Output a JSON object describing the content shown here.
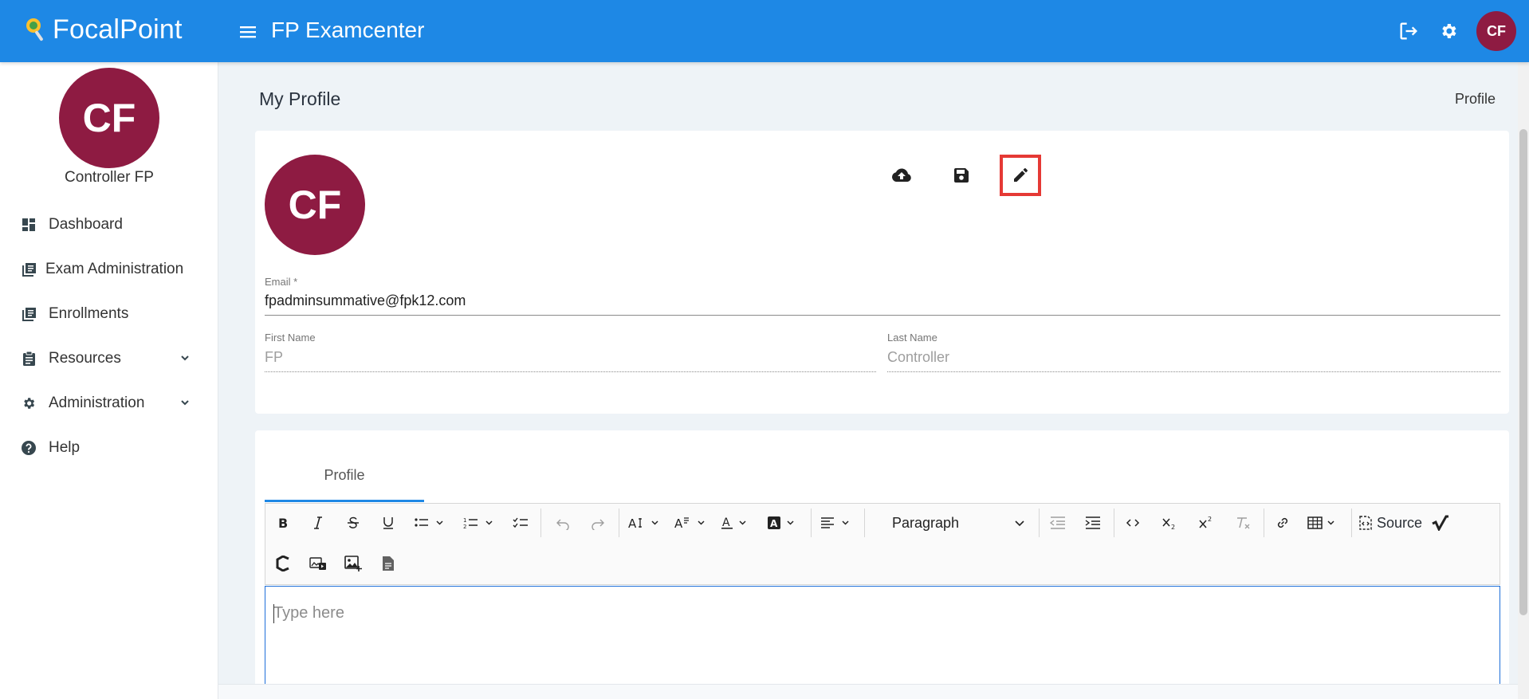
{
  "topbar": {
    "brand": "FocalPoint",
    "app_title": "FP Examcenter",
    "avatar_initials": "CF",
    "color": "#1e88e5"
  },
  "icons": {
    "menu": "menu-icon",
    "logout": "logout-icon",
    "settings": "gear-icon",
    "upload": "cloud-upload-icon",
    "save": "floppy-disk-icon",
    "edit": "pencil-icon"
  },
  "sidebar": {
    "avatar_initials": "CF",
    "username": "Controller FP",
    "items": [
      {
        "label": "Dashboard",
        "icon": "dashboard-icon"
      },
      {
        "label": "Exam Administration",
        "icon": "book-icon"
      },
      {
        "label": "Enrollments",
        "icon": "book-icon"
      },
      {
        "label": "Resources",
        "icon": "clipboard-icon",
        "expandable": true
      },
      {
        "label": "Administration",
        "icon": "gear-icon",
        "expandable": true
      },
      {
        "label": "Help",
        "icon": "help-circle-icon"
      }
    ]
  },
  "page": {
    "title": "My Profile",
    "breadcrumb": "Profile"
  },
  "profile": {
    "avatar_initials": "CF",
    "email_label": "Email *",
    "email_value": "fpadminsummative@fpk12.com",
    "first_name_label": "First Name",
    "first_name_value": "FP",
    "last_name_label": "Last Name",
    "last_name_value": "Controller",
    "avatar_color": "#8e1b42",
    "highlight_color": "#e53935"
  },
  "editor": {
    "tab_label": "Profile",
    "paragraph_select": "Paragraph",
    "source_label": "Source",
    "placeholder": "Type here"
  }
}
